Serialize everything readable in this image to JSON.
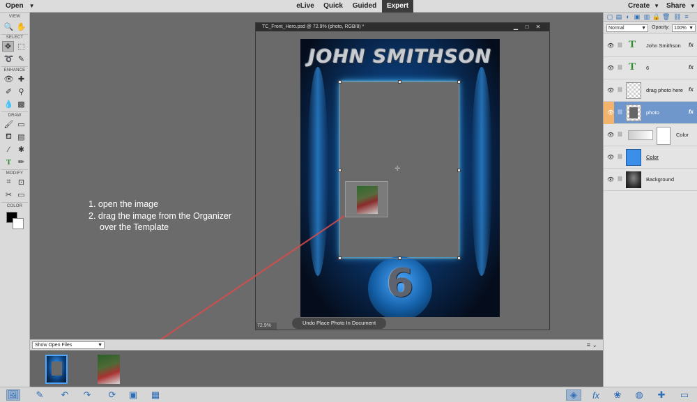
{
  "menubar": {
    "open_label": "Open",
    "modes": [
      "eLive",
      "Quick",
      "Guided",
      "Expert"
    ],
    "active_mode": "Expert",
    "create_label": "Create",
    "share_label": "Share"
  },
  "toolbox": {
    "sections": [
      "VIEW",
      "SELECT",
      "ENHANCE",
      "DRAW",
      "MODIFY",
      "COLOR"
    ],
    "foreground_color": "#000000",
    "background_color": "#ffffff"
  },
  "instructions": {
    "line1": "1. open the image",
    "line2": "2. drag the image from the Organizer",
    "line3": "over the Template"
  },
  "document": {
    "title": "TC_Front_Hero.psd @ 72.9% (photo, RGB/8) *",
    "zoom": "72.9%",
    "poster_name": "JOHN SMITHSON",
    "poster_number": "6",
    "undo_toast": "Undo Place Photo In Document"
  },
  "photobin": {
    "dropdown_value": "Show Open Files"
  },
  "layers_panel": {
    "blend_mode": "Normal",
    "opacity_label": "Opacity:",
    "opacity_value": "100%",
    "layers": [
      {
        "name": "John Smithson",
        "kind": "text",
        "fx": "fx"
      },
      {
        "name": "6",
        "kind": "text",
        "fx": "fx"
      },
      {
        "name": "drag photo here",
        "kind": "image",
        "fx": "fx"
      },
      {
        "name": "photo",
        "kind": "image",
        "fx": "fx",
        "selected": true
      },
      {
        "name": "Color",
        "kind": "adjustment",
        "fx": ""
      },
      {
        "name": "Color",
        "kind": "fill",
        "fx": ""
      },
      {
        "name": "Background",
        "kind": "image",
        "fx": ""
      }
    ]
  },
  "colors": {
    "accent": "#2f6db5",
    "selected_layer": "#7097cc",
    "drag_line": "#d94b4b"
  }
}
